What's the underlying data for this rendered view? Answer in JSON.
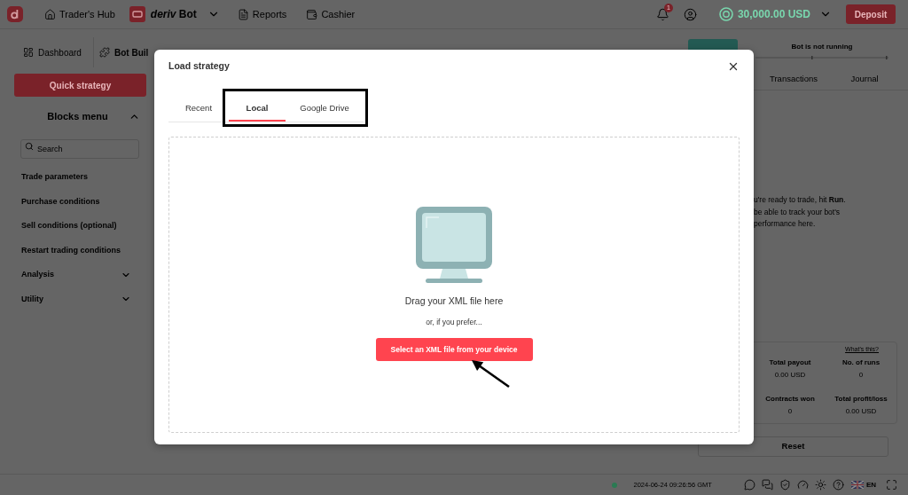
{
  "header": {
    "traders_hub": "Trader's Hub",
    "app_name": "*deriv* Bot",
    "reports": "Reports",
    "cashier": "Cashier",
    "notification_count": "1",
    "balance": "30,000.00 USD",
    "deposit": "Deposit"
  },
  "workspace_tabs": [
    {
      "label": "Dashboard",
      "selected": false
    },
    {
      "label": "Bot Buil",
      "selected": true
    }
  ],
  "sidebar": {
    "quick_strategy": "Quick strategy",
    "blocks_menu": {
      "title": "Blocks menu",
      "expanded": true
    },
    "search": {
      "placeholder": "Search"
    },
    "items": [
      {
        "label": "Trade parameters",
        "kind": "block"
      },
      {
        "label": "Purchase conditions",
        "kind": "block"
      },
      {
        "label": "Sell conditions (optional)",
        "kind": "block"
      },
      {
        "label": "Restart trading conditions",
        "kind": "block"
      },
      {
        "label": "Analysis",
        "kind": "group",
        "expanded": false
      },
      {
        "label": "Utility",
        "kind": "group",
        "expanded": false
      }
    ]
  },
  "run_panel": {
    "status": "Bot is not running",
    "tabs": [
      {
        "label": "Transactions",
        "selected": false
      },
      {
        "label": "Journal",
        "selected": false
      }
    ],
    "message": "u're ready to trade, hit **Run**.\nbe able to track your bot's\nperformance here.",
    "whats_this": "What's this?",
    "stats": [
      {
        "label": "Total payout",
        "value": "0.00 USD"
      },
      {
        "label": "No. of runs",
        "value": "0"
      },
      {
        "label": "Contracts won",
        "value": "0"
      },
      {
        "label": "Total profit/loss",
        "value": "0.00 USD"
      }
    ],
    "reset": "Reset"
  },
  "footer": {
    "online": true,
    "time": "2024-06-24 09:26:56 GMT",
    "language": "EN"
  },
  "modal": {
    "title": "Load strategy",
    "tabs": [
      {
        "label": "Recent",
        "selected": false
      },
      {
        "label": "Local",
        "selected": true
      },
      {
        "label": "Google Drive",
        "selected": false
      }
    ],
    "drop_text": "Drag your XML file here",
    "alt_text": "or, if you prefer...",
    "button": "Select an XML file from your device"
  }
}
